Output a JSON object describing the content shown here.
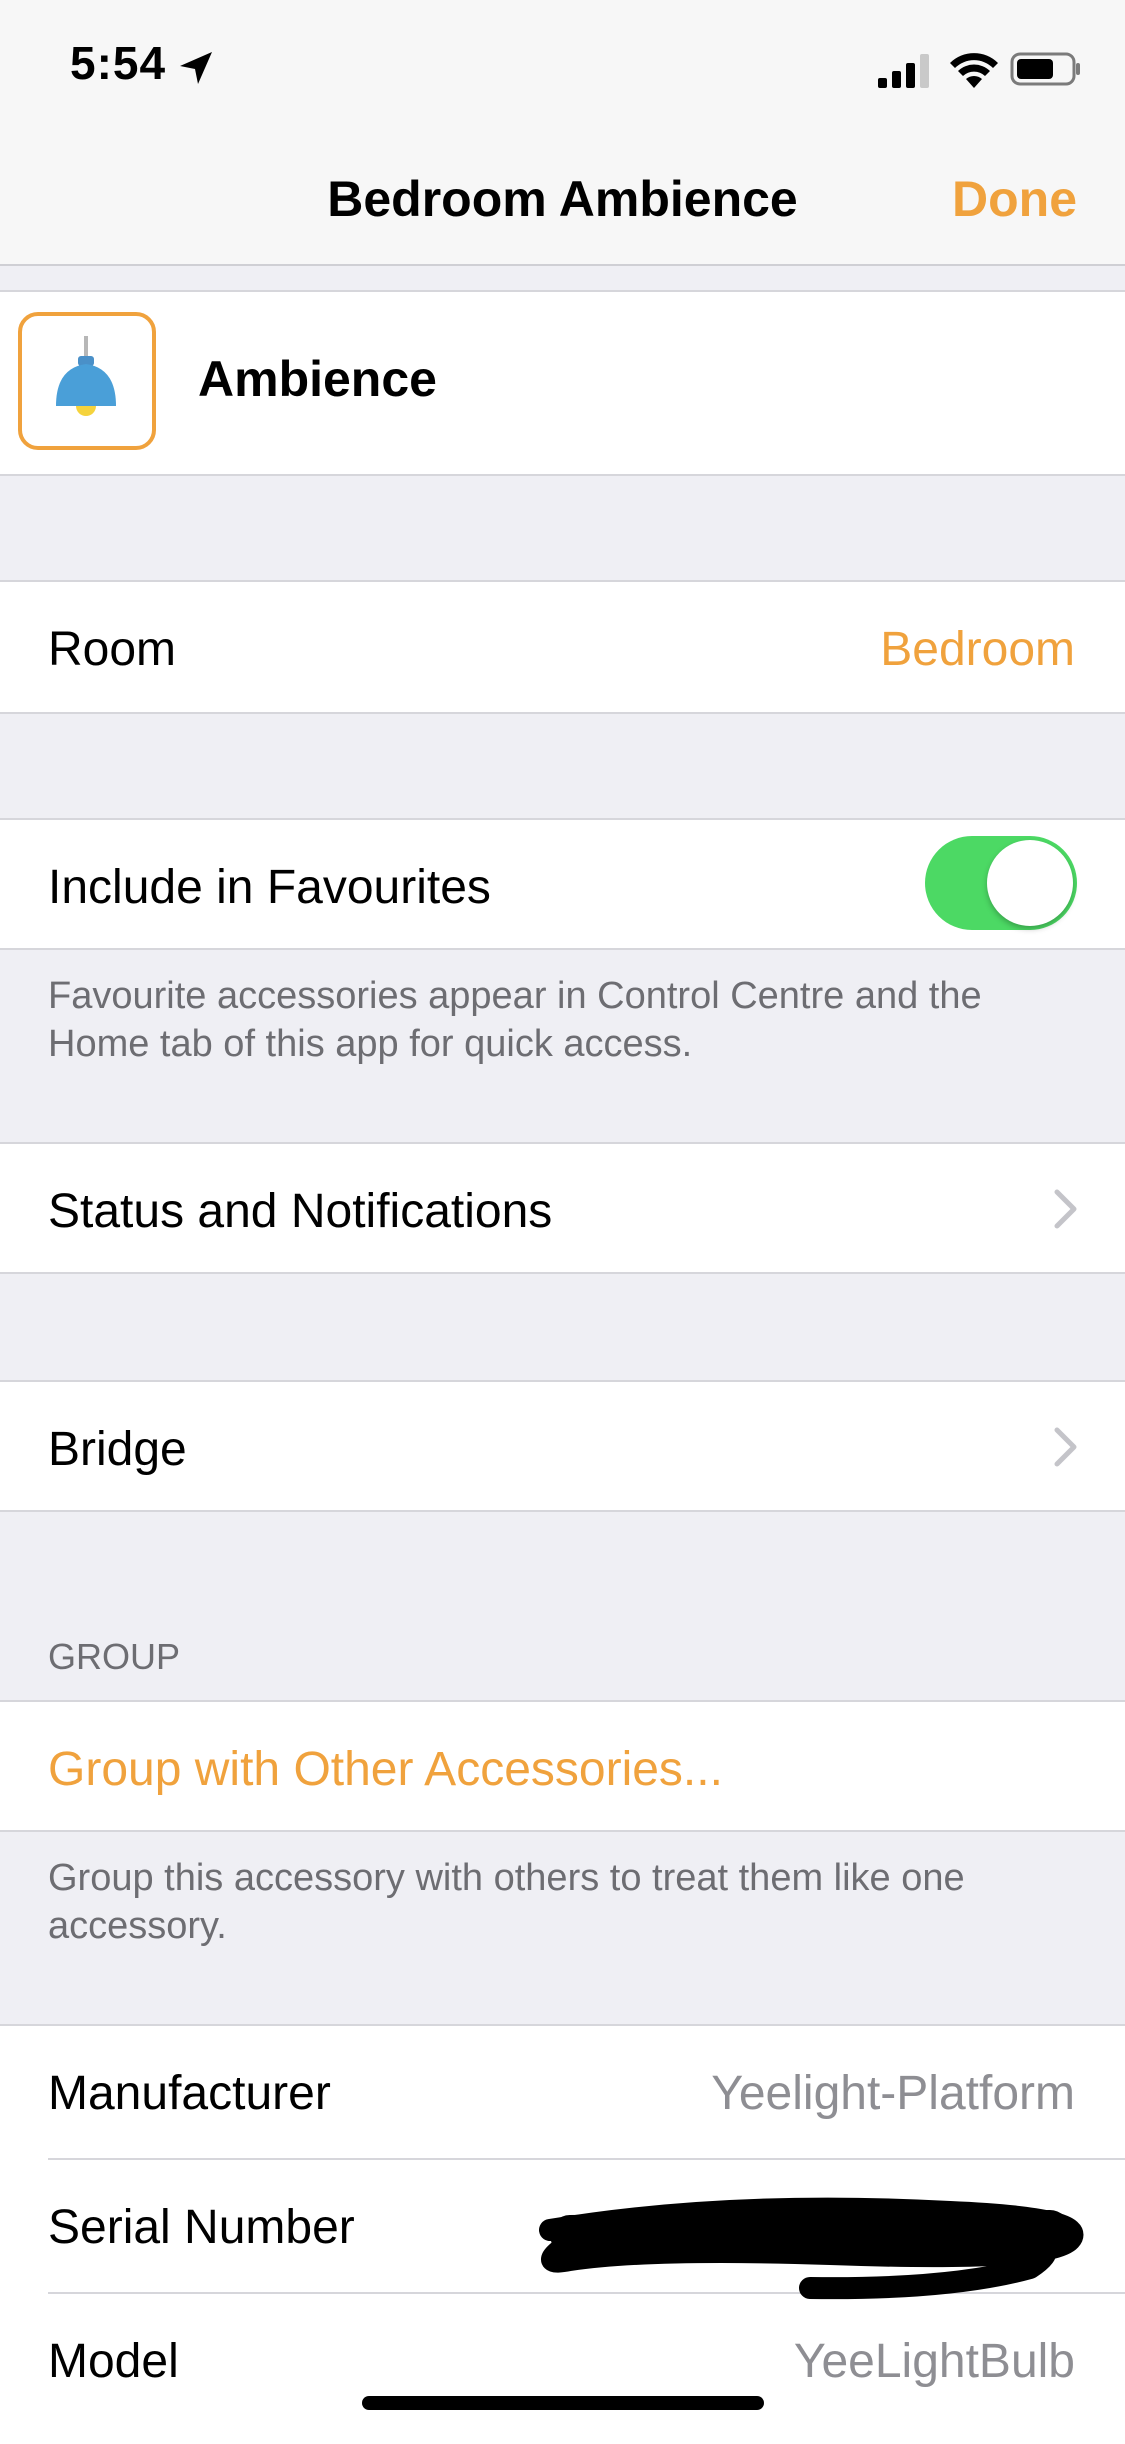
{
  "status_bar": {
    "time": "5:54"
  },
  "nav": {
    "title": "Bedroom Ambience",
    "done_label": "Done"
  },
  "accessory": {
    "name": "Ambience"
  },
  "room": {
    "label": "Room",
    "value": "Bedroom"
  },
  "favourites": {
    "label": "Include in Favourites",
    "enabled": true,
    "footer": "Favourite accessories appear in Control Centre and the Home tab of this app for quick access."
  },
  "status_notifications": {
    "label": "Status and Notifications"
  },
  "bridge": {
    "label": "Bridge"
  },
  "group": {
    "header": "GROUP",
    "action_label": "Group with Other Accessories...",
    "footer": "Group this accessory with others to treat them like one accessory."
  },
  "info": {
    "manufacturer_label": "Manufacturer",
    "manufacturer_value": "Yeelight-Platform",
    "serial_label": "Serial Number",
    "model_label": "Model",
    "model_value": "YeeLightBulb"
  },
  "colors": {
    "accent": "#f0a23d",
    "toggle_on": "#4cd964",
    "background": "#efeff4"
  }
}
